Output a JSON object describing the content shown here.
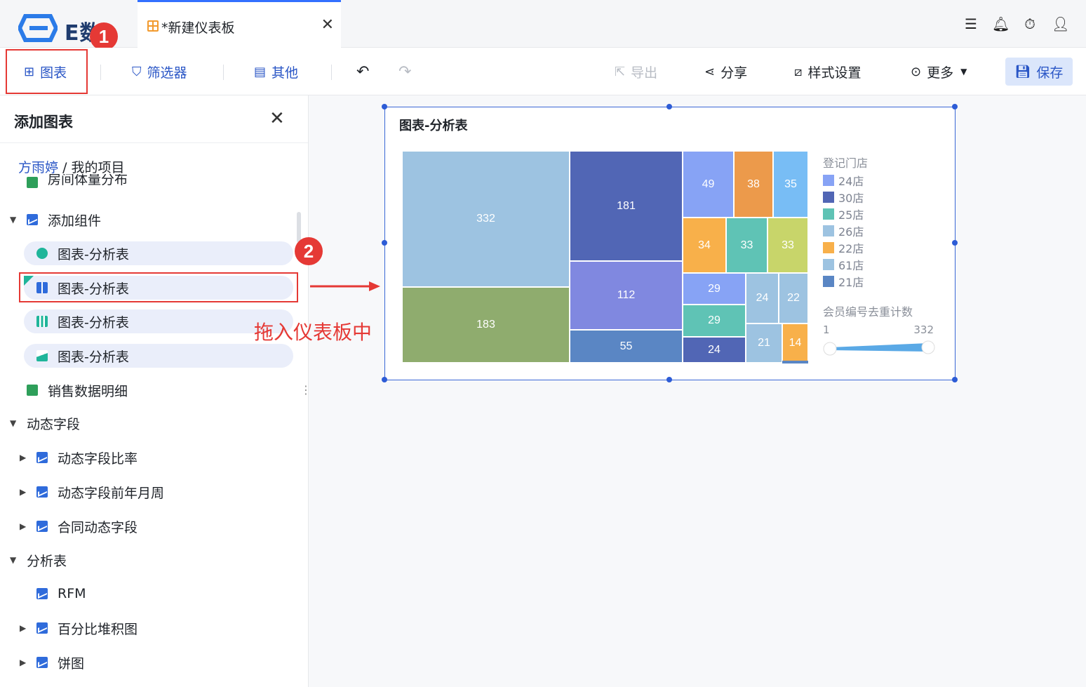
{
  "app": {
    "logo_text": "E数通",
    "tab_title": "*新建仪表板"
  },
  "toolbar": {
    "chart": "图表",
    "filter": "筛选器",
    "other": "其他",
    "export": "导出",
    "share": "分享",
    "style": "样式设置",
    "more": "更多",
    "save": "保存"
  },
  "sidebar": {
    "title": "添加图表",
    "breadcrumb_root": "方雨婷",
    "breadcrumb_sep": "/",
    "breadcrumb_leaf": "我的项目",
    "cut_item": "房间体量分布",
    "group_add": "添加组件",
    "items": [
      "图表-分析表",
      "图表-分析表",
      "图表-分析表",
      "图表-分析表"
    ],
    "sales": "销售数据明细",
    "dyn": "动态字段",
    "dyn_children": [
      "动态字段比率",
      "动态字段前年月周",
      "合同动态字段"
    ],
    "analysis": "分析表",
    "analysis_children": [
      "RFM",
      "百分比堆积图",
      "饼图"
    ]
  },
  "annotations": {
    "badge1": "1",
    "badge2": "2",
    "drag_text": "拖入仪表板中"
  },
  "widget": {
    "title": "图表-分析表"
  },
  "chart_data": {
    "type": "treemap",
    "legend_title": "登记门店",
    "legend": [
      {
        "name": "24店",
        "color": "#87a3f5"
      },
      {
        "name": "30店",
        "color": "#5166b5"
      },
      {
        "name": "25店",
        "color": "#5fc3b5"
      },
      {
        "name": "26店",
        "color": "#9dc3e1"
      },
      {
        "name": "22店",
        "color": "#f8b04a"
      },
      {
        "name": "61店",
        "color": "#9dc3e1"
      },
      {
        "name": "21店",
        "color": "#5a86c4"
      }
    ],
    "values": [
      332,
      183,
      181,
      112,
      55,
      49,
      38,
      35,
      34,
      33,
      33,
      29,
      29,
      24,
      24,
      22,
      21,
      14
    ],
    "range_label": "会员编号去重计数",
    "range_min": "1",
    "range_max": "332"
  }
}
